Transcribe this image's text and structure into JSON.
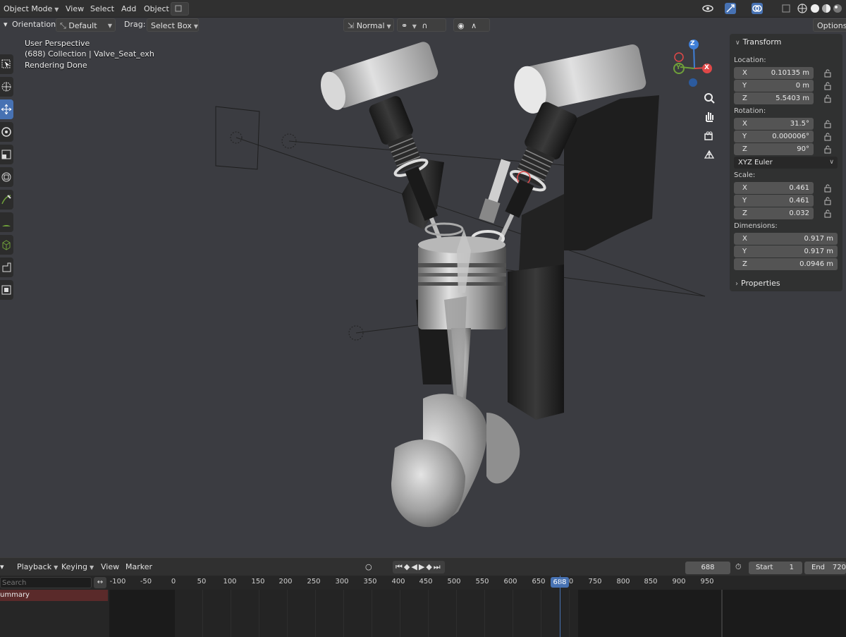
{
  "header": {
    "mode": "Object Mode",
    "menus": [
      "View",
      "Select",
      "Add",
      "Object"
    ],
    "options_label": "Options"
  },
  "tool_settings": {
    "orientation_label": "Orientation:",
    "orientation_value": "Default",
    "drag_label": "Drag:",
    "drag_value": "Select Box",
    "pivot_value": "Normal"
  },
  "viewport": {
    "perspective": "User Perspective",
    "collection": "(688) Collection | Valve_Seat_exh",
    "status": "Rendering Done",
    "icons": [
      "select-box-icon",
      "cursor-icon",
      "move-icon",
      "rotate-icon",
      "scale-icon",
      "transform-icon",
      "annotate-icon",
      "measure-icon",
      "add-cube-icon",
      "extrude-icon",
      "inset-icon"
    ]
  },
  "transform_panel": {
    "title": "Transform",
    "location_label": "Location:",
    "location": [
      {
        "axis": "X",
        "value": "0.10135 m"
      },
      {
        "axis": "Y",
        "value": "0 m"
      },
      {
        "axis": "Z",
        "value": "5.5403 m"
      }
    ],
    "rotation_label": "Rotation:",
    "rotation": [
      {
        "axis": "X",
        "value": "31.5°"
      },
      {
        "axis": "Y",
        "value": "0.000006°"
      },
      {
        "axis": "Z",
        "value": "90°"
      }
    ],
    "rotation_mode": "XYZ Euler",
    "scale_label": "Scale:",
    "scale": [
      {
        "axis": "X",
        "value": "0.461"
      },
      {
        "axis": "Y",
        "value": "0.461"
      },
      {
        "axis": "Z",
        "value": "0.032"
      }
    ],
    "dimensions_label": "Dimensions:",
    "dimensions": [
      {
        "axis": "X",
        "value": "0.917 m"
      },
      {
        "axis": "Y",
        "value": "0.917 m"
      },
      {
        "axis": "Z",
        "value": "0.0946 m"
      }
    ],
    "properties_label": "Properties"
  },
  "gizmo": {
    "x": "X",
    "y": "Y",
    "z": "Z"
  },
  "timeline": {
    "menus": [
      "Playback",
      "Keying",
      "View",
      "Marker"
    ],
    "current_frame": "688",
    "start_label": "Start",
    "start_value": "1",
    "end_label": "End",
    "end_value": "720",
    "search_placeholder": "Search",
    "summary_label": "ummary",
    "ruler_ticks": [
      "-100",
      "-50",
      "0",
      "50",
      "100",
      "150",
      "200",
      "250",
      "300",
      "350",
      "400",
      "450",
      "500",
      "550",
      "600",
      "650",
      "0",
      "750",
      "800",
      "850",
      "900",
      "950"
    ],
    "playhead_label": "688"
  },
  "colors": {
    "accent": "#4772b3",
    "axis_x": "#e04848",
    "axis_y": "#6fa03a",
    "axis_z": "#3f7fd8",
    "summary_bg": "#5a2a2a"
  }
}
